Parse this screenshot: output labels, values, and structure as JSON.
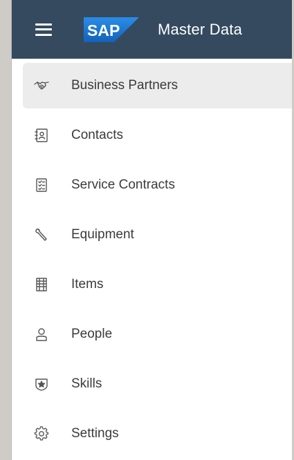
{
  "header": {
    "menu_icon": "hamburger-icon",
    "logo_text": "SAP",
    "title": "Master Data",
    "background_color": "#354a5f",
    "logo_color": "#1f7ad6"
  },
  "nav": {
    "items": [
      {
        "label": "Business Partners",
        "icon": "handshake-icon",
        "selected": true
      },
      {
        "label": "Contacts",
        "icon": "address-book-icon",
        "selected": false
      },
      {
        "label": "Service Contracts",
        "icon": "contract-icon",
        "selected": false
      },
      {
        "label": "Equipment",
        "icon": "wrench-icon",
        "selected": false
      },
      {
        "label": "Items",
        "icon": "list-icon",
        "selected": false
      },
      {
        "label": "People",
        "icon": "person-icon",
        "selected": false
      },
      {
        "label": "Skills",
        "icon": "badge-icon",
        "selected": false
      },
      {
        "label": "Settings",
        "icon": "gear-icon",
        "selected": false
      }
    ]
  }
}
